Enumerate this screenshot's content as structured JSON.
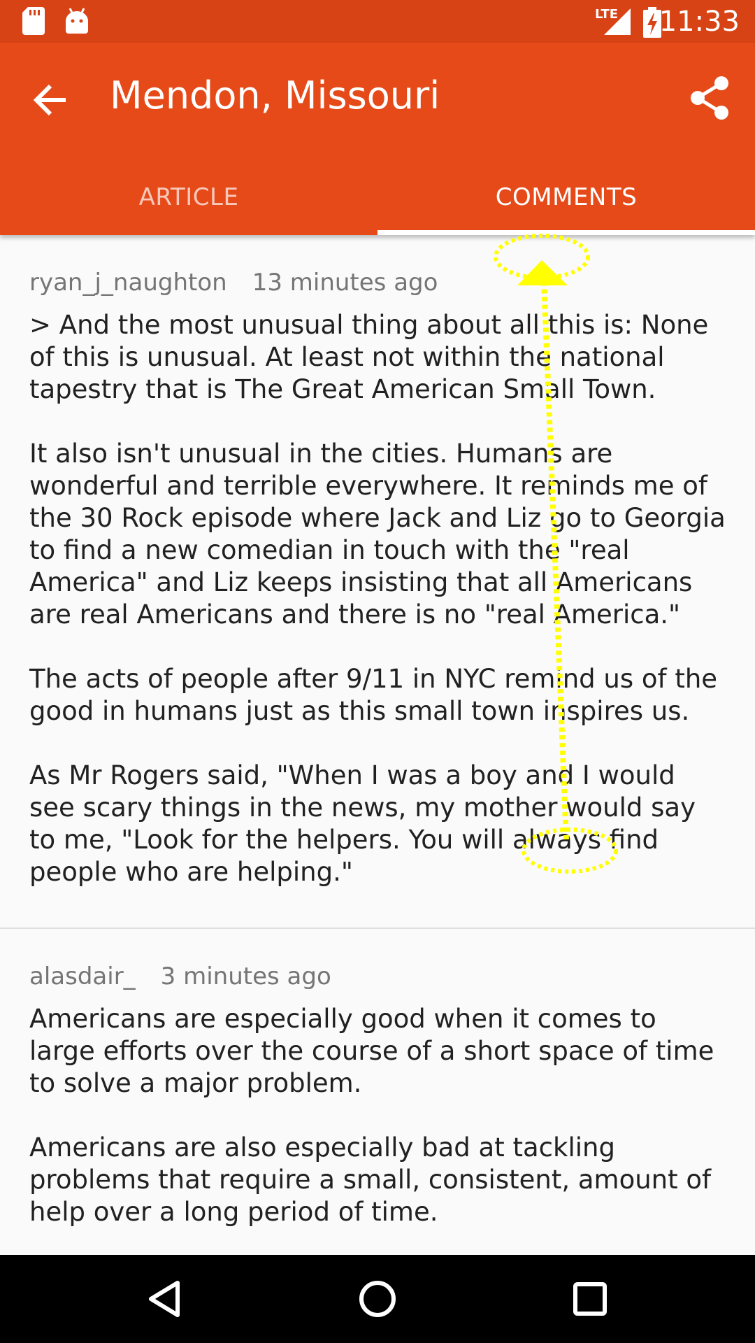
{
  "status_bar": {
    "time": "11:33",
    "network": "LTE",
    "left_icons": [
      "sd-card-icon",
      "android-icon"
    ],
    "right_icons": [
      "signal-icon",
      "battery-charging-icon"
    ]
  },
  "app_bar": {
    "title": "Mendon, Missouri",
    "back_icon": "arrow-back-icon",
    "share_icon": "share-icon",
    "color": "#e64a19"
  },
  "tabs": [
    {
      "label": "ARTICLE",
      "selected": false
    },
    {
      "label": "COMMENTS",
      "selected": true
    }
  ],
  "comments": [
    {
      "author": "ryan_j_naughton",
      "time": "13 minutes ago",
      "paragraphs": [
        "> And the most unusual thing about all this is: None of this is unusual. At least not within the national tapestry that is The Great American Small Town.",
        "It also isn't unusual in the cities. Humans are wonderful and terrible everywhere. It reminds me of the 30 Rock episode where Jack and Liz go to Georgia to find a new comedian in touch with the \"real America\" and Liz keeps insisting that all Americans are real Americans and there is no \"real America.\"",
        "The acts of people after 9/11 in NYC remind us of the good in humans just as this small town inspires us.",
        "As Mr Rogers said, \"When I was a boy and I would see scary things in the news, my mother would say to me, \"Look for the helpers. You will always find people who are helping.\""
      ]
    },
    {
      "author": "alasdair_",
      "time": "3 minutes ago",
      "paragraphs": [
        "Americans are especially good when it comes to large efforts over the course of a short space of time to solve a major problem.",
        "Americans are also especially bad at tackling problems that require a small, consistent, amount of help over a long period of time."
      ]
    }
  ],
  "nav_bar": {
    "buttons": [
      "back-triangle-icon",
      "home-circle-icon",
      "recents-square-icon"
    ]
  },
  "gesture_overlay": {
    "type": "swipe-up",
    "color": "#ffff00"
  }
}
